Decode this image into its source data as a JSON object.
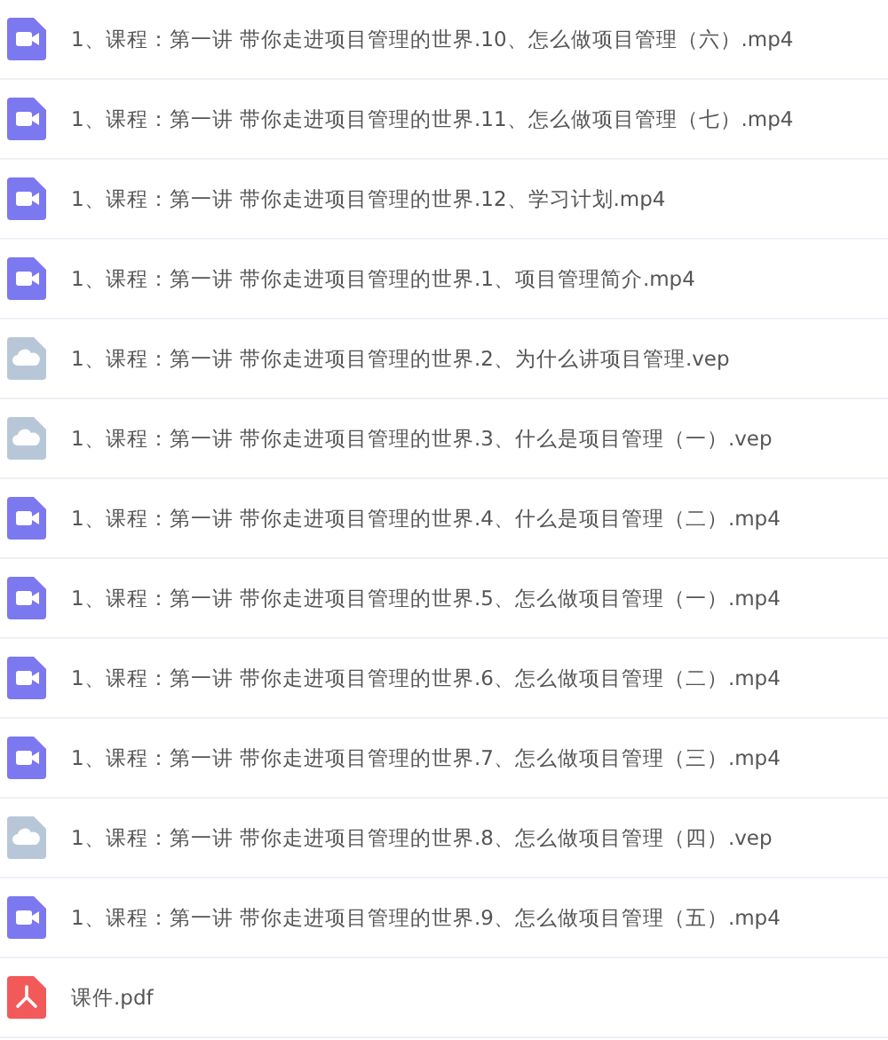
{
  "files": [
    {
      "kind": "video",
      "name": "1、课程：第一讲 带你走进项目管理的世界.10、怎么做项目管理（六）.mp4"
    },
    {
      "kind": "video",
      "name": "1、课程：第一讲 带你走进项目管理的世界.11、怎么做项目管理（七）.mp4"
    },
    {
      "kind": "video",
      "name": "1、课程：第一讲 带你走进项目管理的世界.12、学习计划.mp4"
    },
    {
      "kind": "video",
      "name": "1、课程：第一讲 带你走进项目管理的世界.1、项目管理简介.mp4"
    },
    {
      "kind": "cloud",
      "name": "1、课程：第一讲 带你走进项目管理的世界.2、为什么讲项目管理.vep"
    },
    {
      "kind": "cloud",
      "name": "1、课程：第一讲 带你走进项目管理的世界.3、什么是项目管理（一）.vep"
    },
    {
      "kind": "video",
      "name": "1、课程：第一讲 带你走进项目管理的世界.4、什么是项目管理（二）.mp4"
    },
    {
      "kind": "video",
      "name": "1、课程：第一讲 带你走进项目管理的世界.5、怎么做项目管理（一）.mp4"
    },
    {
      "kind": "video",
      "name": "1、课程：第一讲 带你走进项目管理的世界.6、怎么做项目管理（二）.mp4"
    },
    {
      "kind": "video",
      "name": "1、课程：第一讲 带你走进项目管理的世界.7、怎么做项目管理（三）.mp4"
    },
    {
      "kind": "cloud",
      "name": "1、课程：第一讲 带你走进项目管理的世界.8、怎么做项目管理（四）.vep"
    },
    {
      "kind": "video",
      "name": "1、课程：第一讲 带你走进项目管理的世界.9、怎么做项目管理（五）.mp4"
    },
    {
      "kind": "pdf",
      "name": "课件.pdf"
    }
  ]
}
